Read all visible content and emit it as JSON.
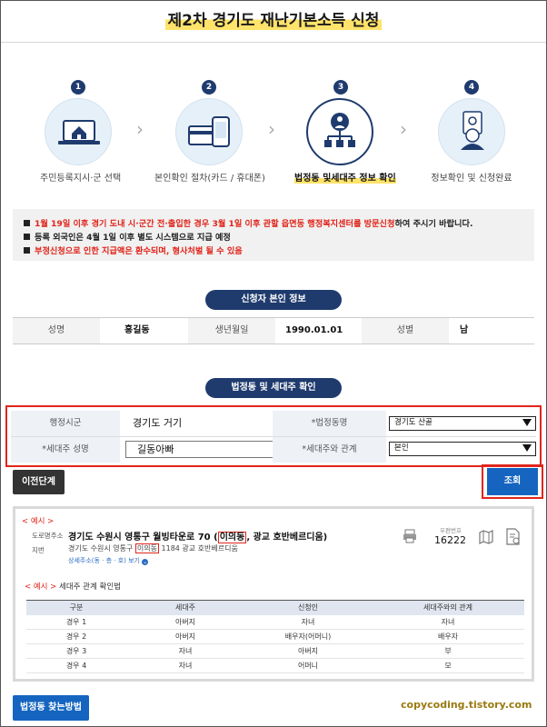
{
  "page": {
    "title": "제2차 경기도 재난기본소득 신청"
  },
  "steps": [
    {
      "num": "1",
      "label": "주민등록지시·군 선택",
      "icon": "laptop-home-icon"
    },
    {
      "num": "2",
      "label": "본인확인 절차(카드 / 휴대폰)",
      "icon": "card-phone-icon"
    },
    {
      "num": "3",
      "label": "법정동 및세대주 정보 확인",
      "icon": "org-chart-person-icon",
      "active": true
    },
    {
      "num": "4",
      "label": "정보확인 및 신청완료",
      "icon": "person-document-icon"
    }
  ],
  "notice": {
    "line1_red": "1월 19일 이후 경기 도내 시·군간 전·출입한 경우 3월 1일 이후 관할 읍면동 행정복지센터를 방문신청",
    "line1_dark": "하여 주시기 바랍니다.",
    "line2": "등록 외국인은 4월 1일 이후 별도 시스템으로 지급 예정",
    "line3": "부정신청으로 인한 지급액은 환수되며, 형사처벌 될 수 있음"
  },
  "applicant": {
    "section_title": "신청자 본인 정보",
    "name_label": "성명",
    "name_value": "홍길동",
    "birth_label": "생년월일",
    "birth_value": "1990.01.01",
    "gender_label": "성별",
    "gender_value": "남"
  },
  "household": {
    "section_title": "법정동 및 세대주 확인",
    "district_label": "행정시군",
    "district_value": "경기도 거기",
    "dong_label": "*법정동명",
    "dong_value": "경기도 산골",
    "head_label": "*세대주 성명",
    "head_value": "길동아빠",
    "relation_label": "*세대주와 관계",
    "relation_value": "본인"
  },
  "buttons": {
    "prev": "이전단계",
    "search": "조회",
    "find_dong": "법정동 찾는방법"
  },
  "example": {
    "tag": "< 예시 >",
    "road_label": "도로명주소",
    "road_prefix": "경기도 수원시 영통구 월빙타운로 70 (",
    "road_highlight": "이의동",
    "road_suffix": ", 광교 호반베르디움)",
    "jibun_label": "지번",
    "jibun_prefix": "경기도 수원시 영통구 ",
    "jibun_highlight": "이의동",
    "jibun_suffix": " 1184 광교 호반베르디움",
    "detail_link": "상세주소(동 · 층 · 호) 보기",
    "zip_label": "우편번호",
    "zip_value": "16222",
    "relation_title_tag": "< 예시 >",
    "relation_title": " 세대주 관계 확인법",
    "table_headers": [
      "구분",
      "세대주",
      "신청인",
      "세대주와의 관계"
    ],
    "table_rows": [
      [
        "경우 1",
        "아버지",
        "자녀",
        "자녀"
      ],
      [
        "경우 2",
        "아버지",
        "배우자(어머니)",
        "배우자"
      ],
      [
        "경우 3",
        "자녀",
        "아버지",
        "부"
      ],
      [
        "경우 4",
        "자녀",
        "어머니",
        "모"
      ]
    ]
  },
  "watermark": "copycoding.tistory.com",
  "colors": {
    "navy": "#1f3b6e",
    "blue": "#1565c0",
    "red": "#e1251b",
    "highlight": "#ffe36a"
  }
}
